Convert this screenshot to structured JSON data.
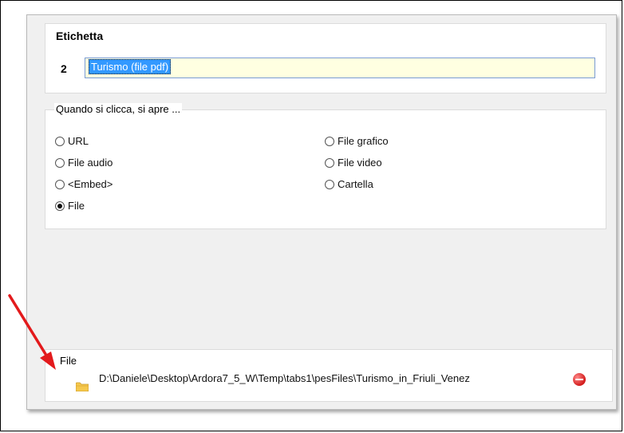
{
  "label_section": {
    "title": "Etichetta",
    "number": "2",
    "value": "Turismo (file pdf)"
  },
  "open_section": {
    "title": "Quando si clicca, si apre ...",
    "options": [
      {
        "label": "URL",
        "checked": false
      },
      {
        "label": "File audio",
        "checked": false
      },
      {
        "label": "<Embed>",
        "checked": false
      },
      {
        "label": "File",
        "checked": true
      },
      {
        "label": "File grafico",
        "checked": false
      },
      {
        "label": "File video",
        "checked": false
      },
      {
        "label": "Cartella",
        "checked": false
      }
    ]
  },
  "file_section": {
    "title": "File",
    "path": "D:\\Daniele\\Desktop\\Ardora7_5_W\\Temp\\tabs1\\pesFiles\\Turismo_in_Friuli_Venez",
    "folder_icon": "folder-icon",
    "remove_icon": "remove-icon"
  },
  "annotation": {
    "arrow_color": "#e31a1c"
  }
}
